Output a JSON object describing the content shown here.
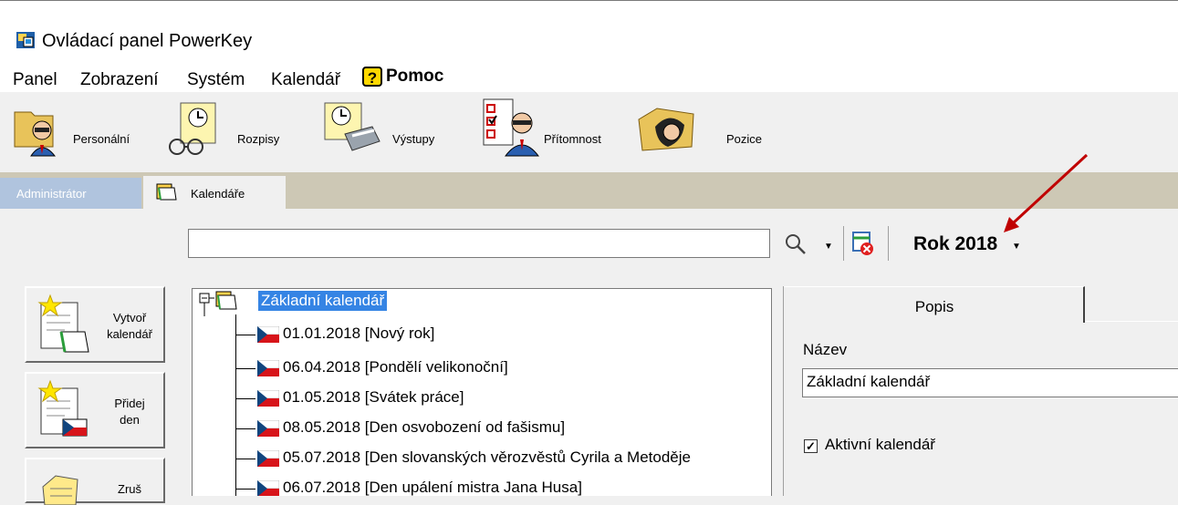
{
  "window": {
    "title": "Ovládací panel PowerKey"
  },
  "menu": {
    "items": [
      {
        "label": "Panel"
      },
      {
        "label": "Zobrazení"
      },
      {
        "label": "Systém"
      },
      {
        "label": "Kalendář"
      }
    ],
    "help": {
      "icon": "?",
      "label": "Pomoc"
    }
  },
  "toolbar": {
    "items": [
      {
        "label": "Personální",
        "icon": "person-folder-icon"
      },
      {
        "label": "Rozpisy",
        "icon": "clock-schedule-icon"
      },
      {
        "label": "Výstupy",
        "icon": "clock-printer-icon"
      },
      {
        "label": "Přítomnost",
        "icon": "attendance-checklist-icon"
      },
      {
        "label": "Pozice",
        "icon": "position-folder-icon"
      }
    ]
  },
  "tabs": [
    {
      "label": "Administrátor",
      "active": false
    },
    {
      "label": "Kalendáře",
      "active": true
    }
  ],
  "search": {
    "value": ""
  },
  "year_selector": {
    "label": "Rok 2018"
  },
  "left_buttons": [
    {
      "line1": "Vytvoř",
      "line2": "kalendář"
    },
    {
      "line1": "Přidej",
      "line2": "den"
    },
    {
      "line1": "Zruš",
      "line2": ""
    }
  ],
  "tree": {
    "root": "Základní kalendář",
    "items": [
      "01.01.2018 [Nový rok]",
      "06.04.2018 [Pondělí velikonoční]",
      "01.05.2018 [Svátek práce]",
      "08.05.2018 [Den osvobození od fašismu]",
      "05.07.2018 [Den slovanských věrozvěstů Cyrila a Metoděje",
      "06.07.2018 [Den upálení mistra Jana Husa]"
    ]
  },
  "details": {
    "tab": "Popis",
    "name_label": "Název",
    "name_value": "Základní kalendář",
    "active_checkbox": {
      "label": "Aktivní kalendář",
      "checked": true
    }
  },
  "colors": {
    "selection": "#3584e4",
    "tabstrip": "#cdc8b5",
    "annotation_arrow": "#c00000"
  }
}
